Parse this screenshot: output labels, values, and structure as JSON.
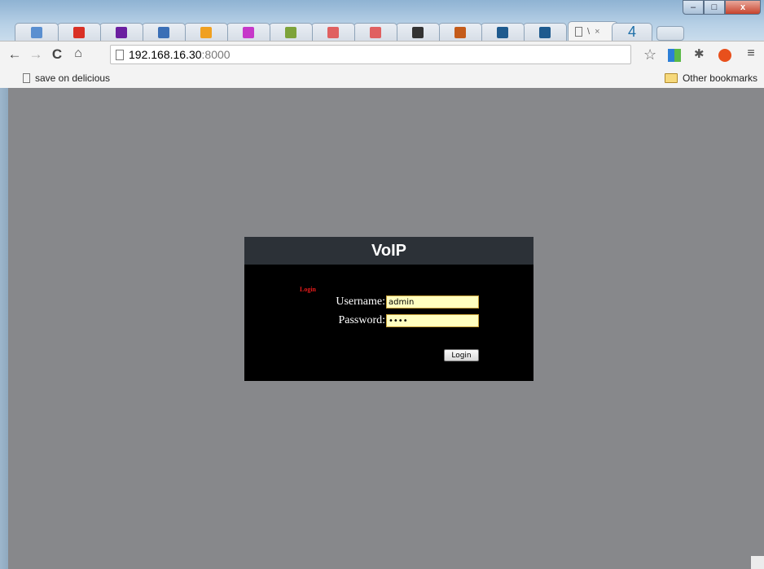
{
  "browser": {
    "tabs": [
      {
        "icon": "wand-icon",
        "color": "#5a8fd0"
      },
      {
        "icon": "gmail-icon",
        "color": "#d93025"
      },
      {
        "icon": "yahoo-icon",
        "color": "#6b1fa0"
      },
      {
        "icon": "zoho-icon",
        "color": "#3b6fb6"
      },
      {
        "icon": "asterisk-icon",
        "color": "#f0a020"
      },
      {
        "icon": "play-icon",
        "color": "#c638c9"
      },
      {
        "icon": "chart-icon",
        "color": "#7da33a"
      },
      {
        "icon": "tool-icon",
        "color": "#e06060"
      },
      {
        "icon": "tool-icon",
        "color": "#e06060"
      },
      {
        "icon": "penguin-icon",
        "color": "#333333"
      },
      {
        "icon": "image-icon",
        "color": "#c45b1a"
      },
      {
        "icon": "cross-icon",
        "color": "#1e5a8e"
      },
      {
        "icon": "cross-icon",
        "color": "#1e5a8e"
      }
    ],
    "active_tab": {
      "label": "\\",
      "close": "×"
    },
    "extra_tab_label": "4",
    "window_buttons": {
      "minimize": "–",
      "maximize": "□",
      "close": "x"
    },
    "address": {
      "host": "192.168.16.30",
      "port": ":8000"
    },
    "bookmarks": {
      "left": "save on delicious",
      "right": "Other bookmarks"
    }
  },
  "page": {
    "header": "VoIP",
    "login_title": "Login",
    "username_label": "Username:",
    "username_value": "admin",
    "password_label": "Password:",
    "password_value": "••••",
    "login_button": "Login"
  }
}
